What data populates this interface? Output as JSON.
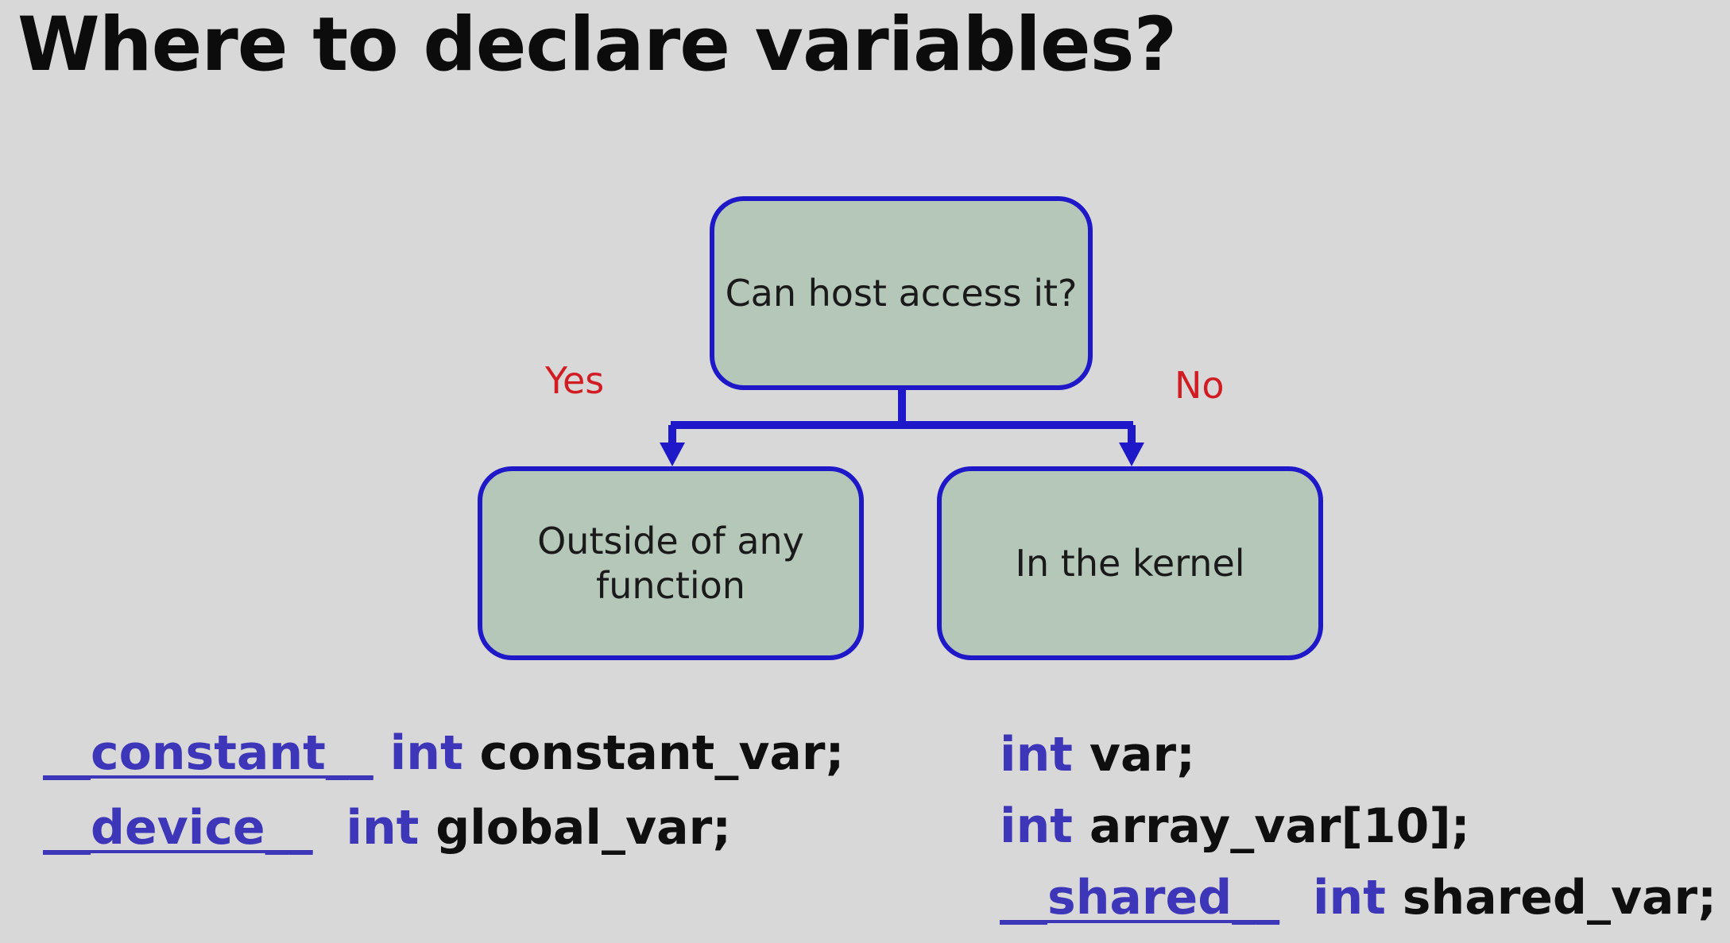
{
  "title": "Where to declare variables?",
  "diagram": {
    "root": "Can host access it?",
    "yes_label": "Yes",
    "no_label": "No",
    "left": "Outside of any function",
    "right": "In the kernel"
  },
  "code": {
    "left": [
      {
        "qualifier": "__constant__",
        "type": "int",
        "decl": "constant_var;"
      },
      {
        "qualifier": "__device__",
        "type": "int",
        "decl": "global_var;"
      }
    ],
    "right": [
      {
        "type": "int",
        "decl": "var;"
      },
      {
        "type": "int",
        "decl": "array_var[10];"
      },
      {
        "qualifier": "__shared__",
        "type": "int",
        "decl": "shared_var;"
      }
    ]
  },
  "colors": {
    "background": "#d8d8d8",
    "box_fill": "#b4c7b8",
    "box_stroke": "#1f18c8",
    "branch_label": "#d01c22",
    "keyword": "#3d36b8"
  }
}
